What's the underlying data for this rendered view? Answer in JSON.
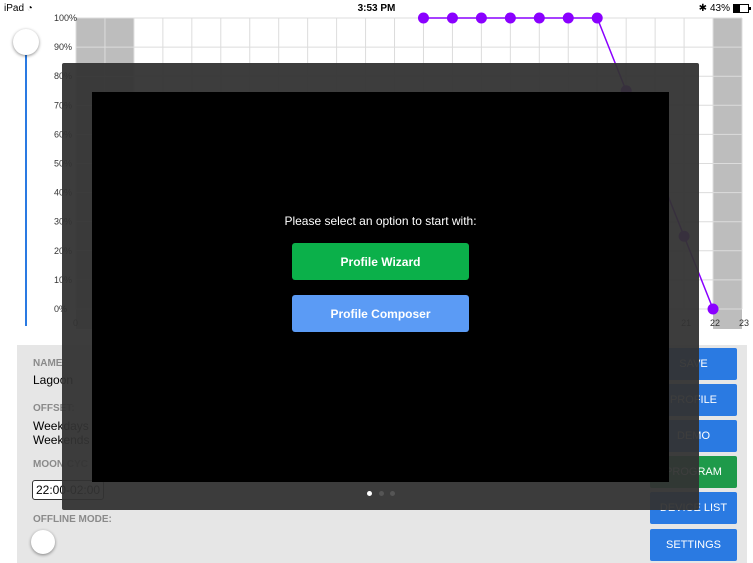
{
  "status_bar": {
    "device": "iPad",
    "wifi_icon": "wifi-icon",
    "time": "3:53 PM",
    "bluetooth_icon": "bluetooth-icon",
    "battery_text": "43%",
    "battery_level": 0.43
  },
  "chart_data": {
    "type": "line",
    "y_ticks": [
      "100%",
      "90%",
      "80%",
      "70%",
      "60%",
      "50%",
      "40%",
      "30%",
      "20%",
      "10%",
      "0%"
    ],
    "x_ticks_visible": [
      "0",
      "21",
      "22",
      "23"
    ],
    "ylim": [
      0,
      100
    ],
    "xlim": [
      0,
      23
    ],
    "series": [
      {
        "color": "#8a00ff",
        "points": [
          [
            12,
            100
          ],
          [
            13,
            100
          ],
          [
            14,
            100
          ],
          [
            15,
            100
          ],
          [
            16,
            100
          ],
          [
            17,
            100
          ],
          [
            18,
            100
          ],
          [
            19,
            75
          ],
          [
            21,
            25
          ],
          [
            22,
            0
          ]
        ]
      }
    ],
    "grid": true,
    "shaded_ranges": [
      [
        0,
        2
      ],
      [
        22,
        23
      ]
    ]
  },
  "slider": {
    "level": 1.0
  },
  "panel": {
    "name_label": "NAME",
    "name_value": "Lagoon",
    "offset_label": "OFFSET:",
    "offset_weekdays": "Weekdays",
    "offset_weekends": "Weekends",
    "moon_label": "MOON CYC",
    "moon_value": "22:00-02:00",
    "offline_label": "OFFLINE MODE:"
  },
  "side_buttons": {
    "save": "SAVE",
    "profile": "PROFILE",
    "demo": "DEMO",
    "program": "PROGRAM",
    "device_list": "DEVICE LIST",
    "settings": "SETTINGS"
  },
  "modal": {
    "prompt": "Please select an option to start with:",
    "wizard_label": "Profile Wizard",
    "composer_label": "Profile Composer",
    "page_count": 3,
    "active_page": 1
  },
  "colors": {
    "accent_blue": "#2a7ae2",
    "green": "#0bb04a",
    "line_purple": "#8a00ff"
  }
}
